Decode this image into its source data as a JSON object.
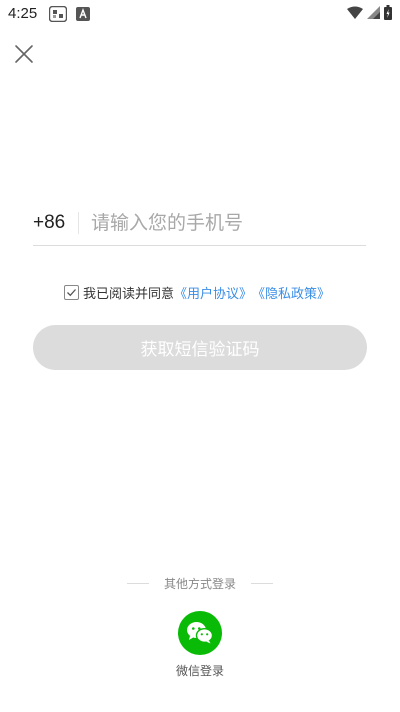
{
  "status_bar": {
    "time": "4:25"
  },
  "icons": {
    "close": "close-icon",
    "checkbox": "check-icon",
    "wechat": "wechat-icon",
    "wifi": "wifi-icon",
    "signal": "signal-icon",
    "battery": "battery-icon"
  },
  "login": {
    "country_code": "+86",
    "phone_placeholder": "请输入您的手机号",
    "phone_value": "",
    "agree_checked": true,
    "agree_text": "我已阅读并同意",
    "user_agreement": "《用户协议》",
    "privacy_policy": "《隐私政策》",
    "sms_button": "获取短信验证码"
  },
  "other_login": {
    "title": "其他方式登录",
    "wechat_label": "微信登录"
  },
  "colors": {
    "link": "#3a8ee6",
    "button_disabled": "#dcdcdc",
    "wechat_green": "#09bb07"
  }
}
